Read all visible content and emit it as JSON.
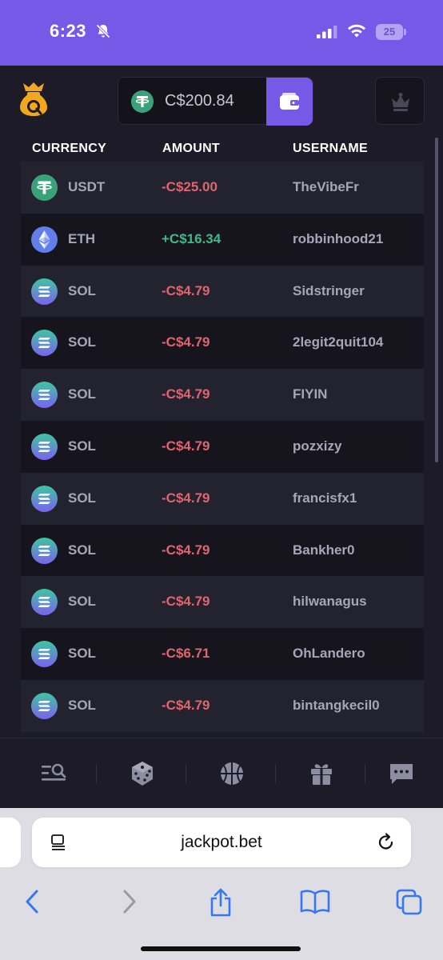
{
  "status_bar": {
    "time": "6:23",
    "battery": "25"
  },
  "header": {
    "balance": "C$200.84"
  },
  "table": {
    "headers": {
      "currency": "CURRENCY",
      "amount": "AMOUNT",
      "username": "USERNAME"
    },
    "rows": [
      {
        "currency": "USDT",
        "amount": "-C$25.00",
        "username": "TheVibeFr"
      },
      {
        "currency": "ETH",
        "amount": "+C$16.34",
        "username": "robbinhood21"
      },
      {
        "currency": "SOL",
        "amount": "-C$4.79",
        "username": "Sidstringer"
      },
      {
        "currency": "SOL",
        "amount": "-C$4.79",
        "username": "2legit2quit104"
      },
      {
        "currency": "SOL",
        "amount": "-C$4.79",
        "username": "FIYIN"
      },
      {
        "currency": "SOL",
        "amount": "-C$4.79",
        "username": "pozxizy"
      },
      {
        "currency": "SOL",
        "amount": "-C$4.79",
        "username": "francisfx1"
      },
      {
        "currency": "SOL",
        "amount": "-C$4.79",
        "username": "Bankher0"
      },
      {
        "currency": "SOL",
        "amount": "-C$4.79",
        "username": "hilwanagus"
      },
      {
        "currency": "SOL",
        "amount": "-C$6.71",
        "username": "OhLandero"
      },
      {
        "currency": "SOL",
        "amount": "-C$4.79",
        "username": "bintangkecil0"
      }
    ]
  },
  "bottom_nav": {
    "items": [
      "search-icon",
      "dice-icon",
      "basketball-icon",
      "gift-icon",
      "chat-icon"
    ]
  },
  "browser": {
    "url": "jackpot.bet"
  },
  "colors": {
    "accent": "#7659e6",
    "negative": "#e0656e",
    "positive": "#3fb98a",
    "background": "#1c1b27"
  }
}
